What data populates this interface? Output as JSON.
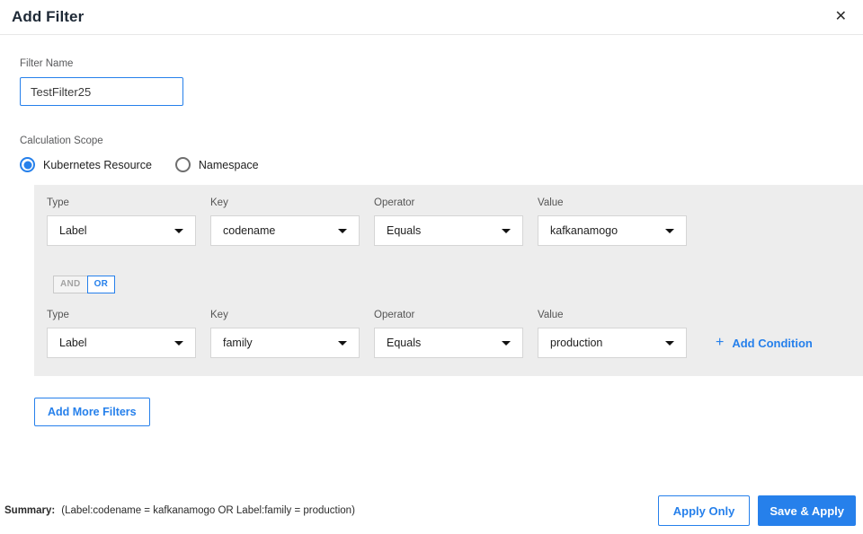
{
  "header": {
    "title": "Add Filter",
    "close_icon": "✕"
  },
  "filter_name": {
    "label": "Filter Name",
    "value": "TestFilter25"
  },
  "calculation_scope": {
    "label": "Calculation Scope",
    "options": [
      {
        "label": "Kubernetes Resource",
        "selected": true
      },
      {
        "label": "Namespace",
        "selected": false
      }
    ]
  },
  "conditions": {
    "field_labels": {
      "type": "Type",
      "key": "Key",
      "operator": "Operator",
      "value": "Value"
    },
    "rows": [
      {
        "type": "Label",
        "key": "codename",
        "operator": "Equals",
        "value": "kafkanamogo"
      },
      {
        "type": "Label",
        "key": "family",
        "operator": "Equals",
        "value": "production"
      }
    ],
    "logic_toggle": {
      "and_label": "AND",
      "or_label": "OR",
      "selected": "OR"
    },
    "add_condition": {
      "plus": "+",
      "label": "Add Condition"
    }
  },
  "add_more_filters_label": "Add More Filters",
  "footer": {
    "summary_label": "Summary:",
    "summary_text": "(Label:codename = kafkanamogo OR Label:family = production)",
    "apply_only_label": "Apply Only",
    "save_apply_label": "Save & Apply"
  },
  "colors": {
    "accent": "#2680eb",
    "panel_bg": "#ededed",
    "title_text": "#1e2936"
  }
}
